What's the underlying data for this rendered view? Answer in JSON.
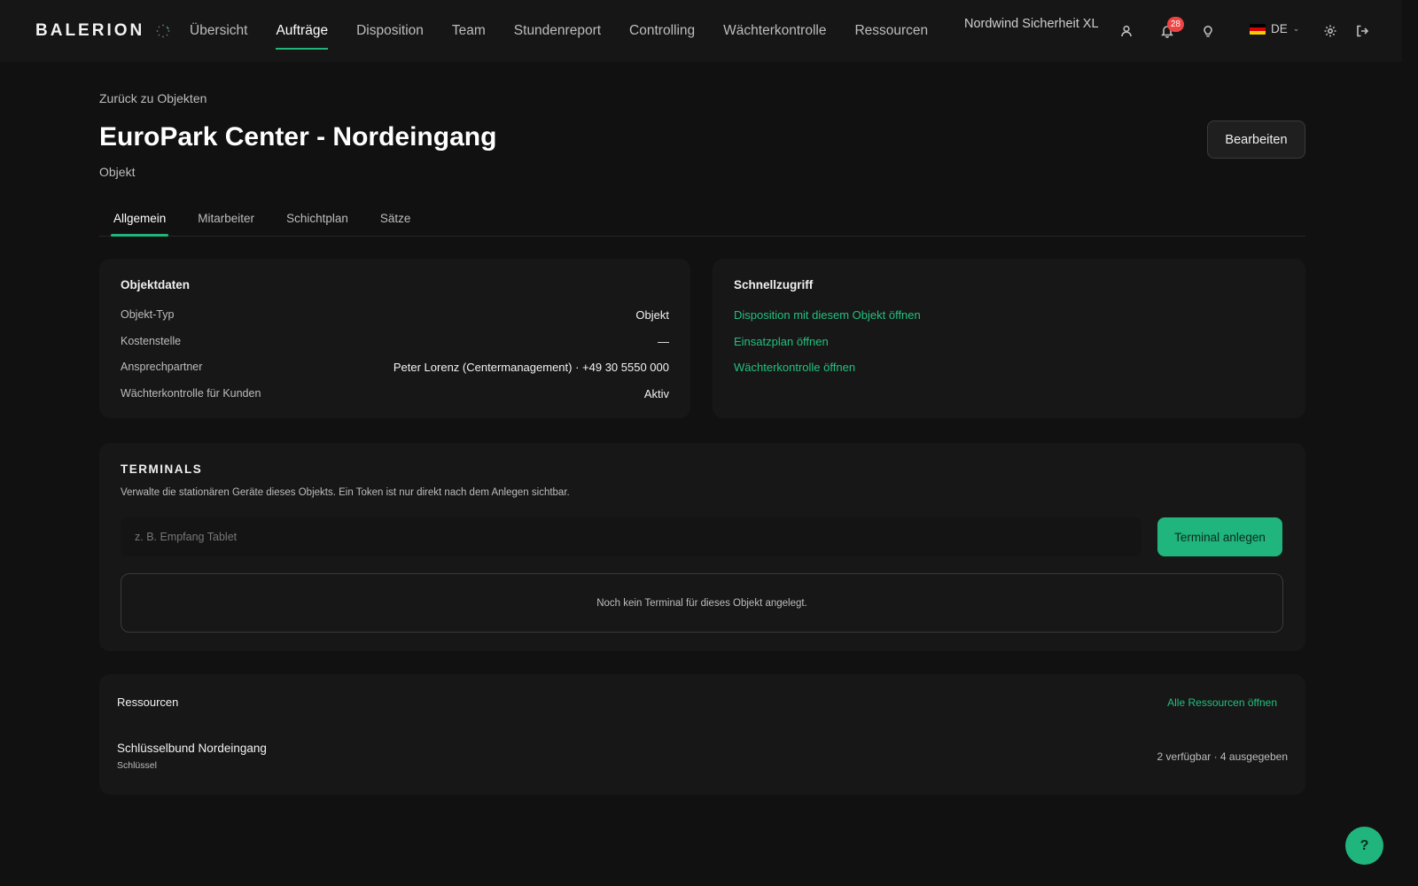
{
  "app": {
    "logo": "BALERION"
  },
  "nav": {
    "items": [
      "Übersicht",
      "Aufträge",
      "Disposition",
      "Team",
      "Stundenreport",
      "Controlling",
      "Wächterkontrolle",
      "Ressourcen"
    ],
    "active": "Aufträge"
  },
  "header": {
    "company": "Nordwind Sicherheit XL",
    "notifications_count": "28",
    "language": "DE",
    "icons": [
      "user-icon",
      "bell-icon",
      "lightbulb-icon",
      "gear-icon",
      "logout-icon"
    ]
  },
  "page": {
    "back_link": "Zurück zu Objekten",
    "title": "EuroPark Center - Nordeingang",
    "subtitle": "Objekt",
    "edit_button": "Bearbeiten"
  },
  "tabs": [
    "Allgemein",
    "Mitarbeiter",
    "Schichtplan",
    "Sätze"
  ],
  "object_data": {
    "title": "Objektdaten",
    "rows": [
      {
        "label": "Objekt-Typ",
        "value": "Objekt"
      },
      {
        "label": "Kostenstelle",
        "value": "—"
      },
      {
        "label": "Ansprechpartner",
        "value": "Peter Lorenz (Centermanagement) · +49 30 5550 000"
      },
      {
        "label": "Wächterkontrolle für Kunden",
        "value": "Aktiv"
      }
    ]
  },
  "quick_access": {
    "title": "Schnellzugriff",
    "links": [
      "Disposition mit diesem Objekt öffnen",
      "Einsatzplan öffnen",
      "Wächterkontrolle öffnen"
    ]
  },
  "terminals": {
    "title": "TERMINALS",
    "description": "Verwalte die stationären Geräte dieses Objekts. Ein Token ist nur direkt nach dem Anlegen sichtbar.",
    "input_placeholder": "z. B. Empfang Tablet",
    "input_value": "",
    "create_button": "Terminal anlegen",
    "empty_text": "Noch kein Terminal für dieses Objekt angelegt."
  },
  "resources": {
    "title": "Ressourcen",
    "open_all": "Alle Ressourcen öffnen",
    "items": [
      {
        "name": "Schlüsselbund Nordeingang",
        "type": "Schlüssel",
        "status": "2 verfügbar · 4 ausgegeben"
      }
    ]
  },
  "help_button": "?",
  "colors": {
    "accent": "#22b47a",
    "background": "#111111",
    "card": "#171717",
    "badge": "#ef4444"
  }
}
